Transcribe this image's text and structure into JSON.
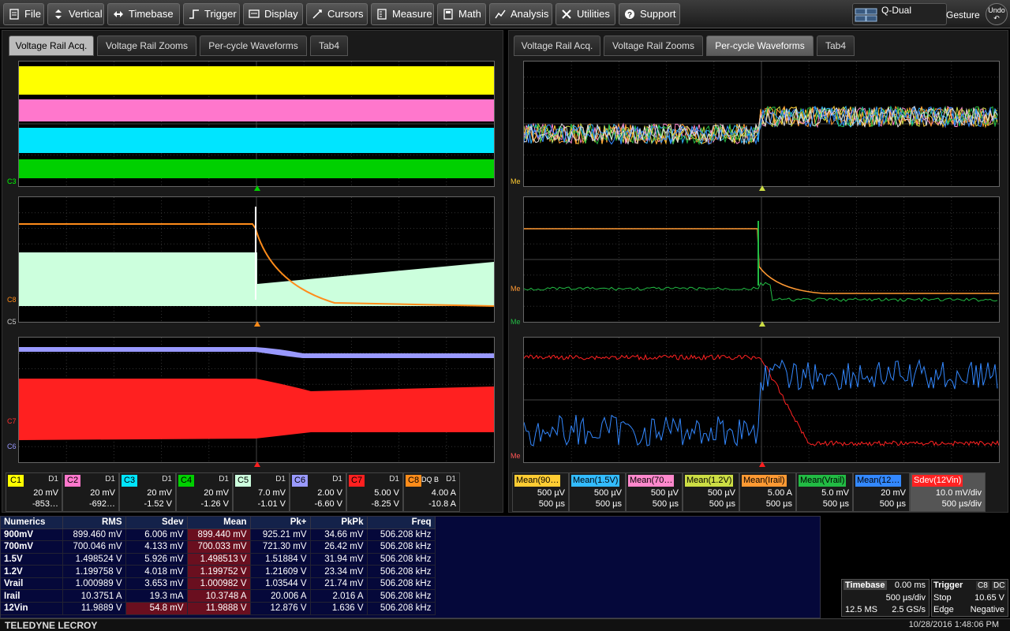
{
  "menu": {
    "items": [
      {
        "label": "File",
        "icon": "document-icon"
      },
      {
        "label": "Vertical",
        "icon": "vertical-arrows-icon"
      },
      {
        "label": "Timebase",
        "icon": "horizontal-arrows-icon"
      },
      {
        "label": "Trigger",
        "icon": "trigger-icon"
      },
      {
        "label": "Display",
        "icon": "display-icon"
      },
      {
        "label": "Cursors",
        "icon": "cursors-icon"
      },
      {
        "label": "Measure",
        "icon": "measure-icon"
      },
      {
        "label": "Math",
        "icon": "calculator-icon"
      },
      {
        "label": "Analysis",
        "icon": "analysis-icon"
      },
      {
        "label": "Utilities",
        "icon": "tools-icon"
      },
      {
        "label": "Support",
        "icon": "help-icon"
      }
    ],
    "display_mode": "Q-Dual",
    "gesture": "Gesture",
    "undo": "Undo"
  },
  "left_panel": {
    "tabs": [
      "Voltage Rail Acq.",
      "Voltage Rail Zooms",
      "Per-cycle Waveforms",
      "Tab4"
    ],
    "active_tab": 0,
    "grid_labels": {
      "g1": "C3",
      "g2a": "C8",
      "g2b": "C5",
      "g3a": "C7",
      "g3b": "C6"
    }
  },
  "right_panel": {
    "tabs": [
      "Voltage Rail Acq.",
      "Voltage Rail Zooms",
      "Per-cycle Waveforms",
      "Tab4"
    ],
    "active_tab": 2,
    "grid_labels": {
      "g1": "Me",
      "g2a": "Me",
      "g2b": "Me",
      "g3": "Me"
    }
  },
  "channels": [
    {
      "name": "C1",
      "color": "#ffff00",
      "coupling": "D1",
      "v1": "20 mV",
      "v2": "-853…"
    },
    {
      "name": "C2",
      "color": "#ff77cc",
      "coupling": "D1",
      "v1": "20 mV",
      "v2": "-692…"
    },
    {
      "name": "C3",
      "color": "#00e5ff",
      "coupling": "D1",
      "v1": "20 mV",
      "v2": "-1.52 V"
    },
    {
      "name": "C4",
      "color": "#00d000",
      "coupling": "D1",
      "v1": "20 mV",
      "v2": "-1.26 V"
    },
    {
      "name": "C5",
      "color": "#ccffdd",
      "coupling": "D1",
      "v1": "7.0 mV",
      "v2": "-1.01 V"
    },
    {
      "name": "C6",
      "color": "#9999ff",
      "coupling": "D1",
      "v1": "2.00 V",
      "v2": "-6.60 V"
    },
    {
      "name": "C7",
      "color": "#ff2020",
      "coupling": "D1",
      "v1": "5.00 V",
      "v2": "-8.25 V"
    },
    {
      "name": "C8",
      "color": "#ff8c1a",
      "coupling": "D1",
      "extra": "DQ B",
      "v1": "4.00 A",
      "v2": "-10.8 A"
    }
  ],
  "math": [
    {
      "name": "Mean(90…",
      "color": "#ffcc33",
      "v1": "500 µV",
      "v2": "500 µs"
    },
    {
      "name": "Mean(1.5V)",
      "color": "#33bbff",
      "v1": "500 µV",
      "v2": "500 µs"
    },
    {
      "name": "Mean(70…",
      "color": "#ff88cc",
      "v1": "500 µV",
      "v2": "500 µs"
    },
    {
      "name": "Mean(1.2V)",
      "color": "#ccdd44",
      "v1": "500 µV",
      "v2": "500 µs"
    },
    {
      "name": "Mean(Irail)",
      "color": "#ff9933",
      "v1": "5.00 A",
      "v2": "500 µs"
    },
    {
      "name": "Mean(Vrail)",
      "color": "#22bb44",
      "v1": "5.0 mV",
      "v2": "500 µs"
    },
    {
      "name": "Mean(12…",
      "color": "#3388ff",
      "v1": "20 mV",
      "v2": "500 µs"
    }
  ],
  "sdev": {
    "name": "Sdev(12Vin)",
    "color": "#ff2222",
    "v1": "10.0 mV/div",
    "v2": "500 µs/div"
  },
  "numerics": {
    "headers": [
      "Numerics",
      "RMS",
      "Sdev",
      "Mean",
      "Pk+",
      "PkPk",
      "Freq"
    ],
    "rows": [
      [
        "900mV",
        "899.460 mV",
        "6.006 mV",
        "899.440 mV",
        "925.21 mV",
        "34.66 mV",
        "506.208 kHz"
      ],
      [
        "700mV",
        "700.046 mV",
        "4.133 mV",
        "700.033 mV",
        "721.30 mV",
        "26.42 mV",
        "506.208 kHz"
      ],
      [
        "1.5V",
        "1.498524 V",
        "5.926 mV",
        "1.498513 V",
        "1.51884 V",
        "31.94 mV",
        "506.208 kHz"
      ],
      [
        "1.2V",
        "1.199758 V",
        "4.018 mV",
        "1.199752 V",
        "1.21609 V",
        "23.34 mV",
        "506.208 kHz"
      ],
      [
        "Vrail",
        "1.000989 V",
        "3.653 mV",
        "1.000982 V",
        "1.03544 V",
        "21.74 mV",
        "506.208 kHz"
      ],
      [
        "Irail",
        "10.3751 A",
        "19.3 mA",
        "10.3748 A",
        "20.006 A",
        "2.016 A",
        "506.208 kHz"
      ],
      [
        "12Vin",
        "11.9889 V",
        "54.8 mV",
        "11.9888 V",
        "12.876 V",
        "1.636 V",
        "506.208 kHz"
      ]
    ]
  },
  "timebase": {
    "label": "Timebase",
    "offset": "0.00 ms",
    "div": "500 µs/div",
    "samples": "12.5 MS",
    "rate": "2.5 GS/s"
  },
  "trigger": {
    "label": "Trigger",
    "src": "C8",
    "coupling": "DC",
    "mode": "Stop",
    "level": "10.65 V",
    "type": "Edge",
    "slope": "Negative"
  },
  "status": {
    "brand": "TELEDYNE LECROY",
    "datetime": "10/28/2016 1:48:06 PM"
  }
}
